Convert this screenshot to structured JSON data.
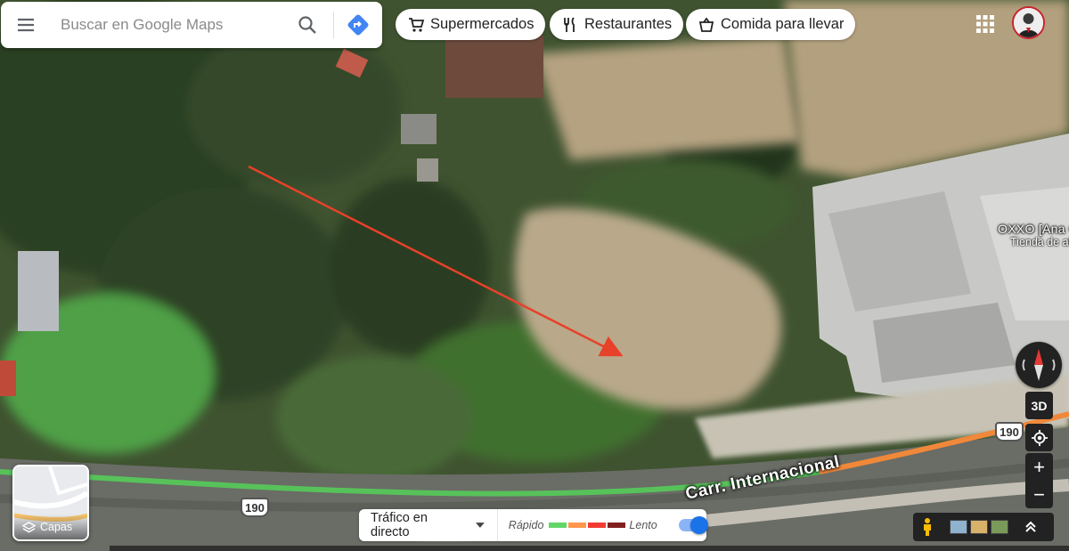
{
  "search": {
    "placeholder": "Buscar en Google Maps"
  },
  "icons": {
    "menu": "menu-icon",
    "search": "search-icon",
    "directions": "directions-icon",
    "apps": "apps-grid-icon",
    "layers": "layers-icon",
    "pegman": "pegman-icon"
  },
  "chips": [
    {
      "label": "Supermercados",
      "icon": "shopping-cart-icon"
    },
    {
      "label": "Restaurantes",
      "icon": "fork-knife-icon"
    },
    {
      "label": "Comida para llevar",
      "icon": "takeout-bag-icon"
    }
  ],
  "map": {
    "poi_name": "OXXO [Ana C",
    "poi_category": "Tienda de al",
    "road_name": "Carr. Internacional",
    "route_shields": [
      "190",
      "190"
    ]
  },
  "controls": {
    "view_3d": "3D",
    "zoom_in": "+",
    "zoom_out": "−"
  },
  "layers": {
    "label": "Capas"
  },
  "traffic": {
    "title": "Tráfico en directo",
    "fast_label": "Rápido",
    "slow_label": "Lento",
    "enabled": true,
    "legend_colors": [
      "#63d668",
      "#ff974d",
      "#f23c32",
      "#811f1f"
    ]
  },
  "colors": {
    "accent_blue": "#1a73e8",
    "directions_blue": "#4285f4",
    "arrow_red": "#e8412a"
  }
}
